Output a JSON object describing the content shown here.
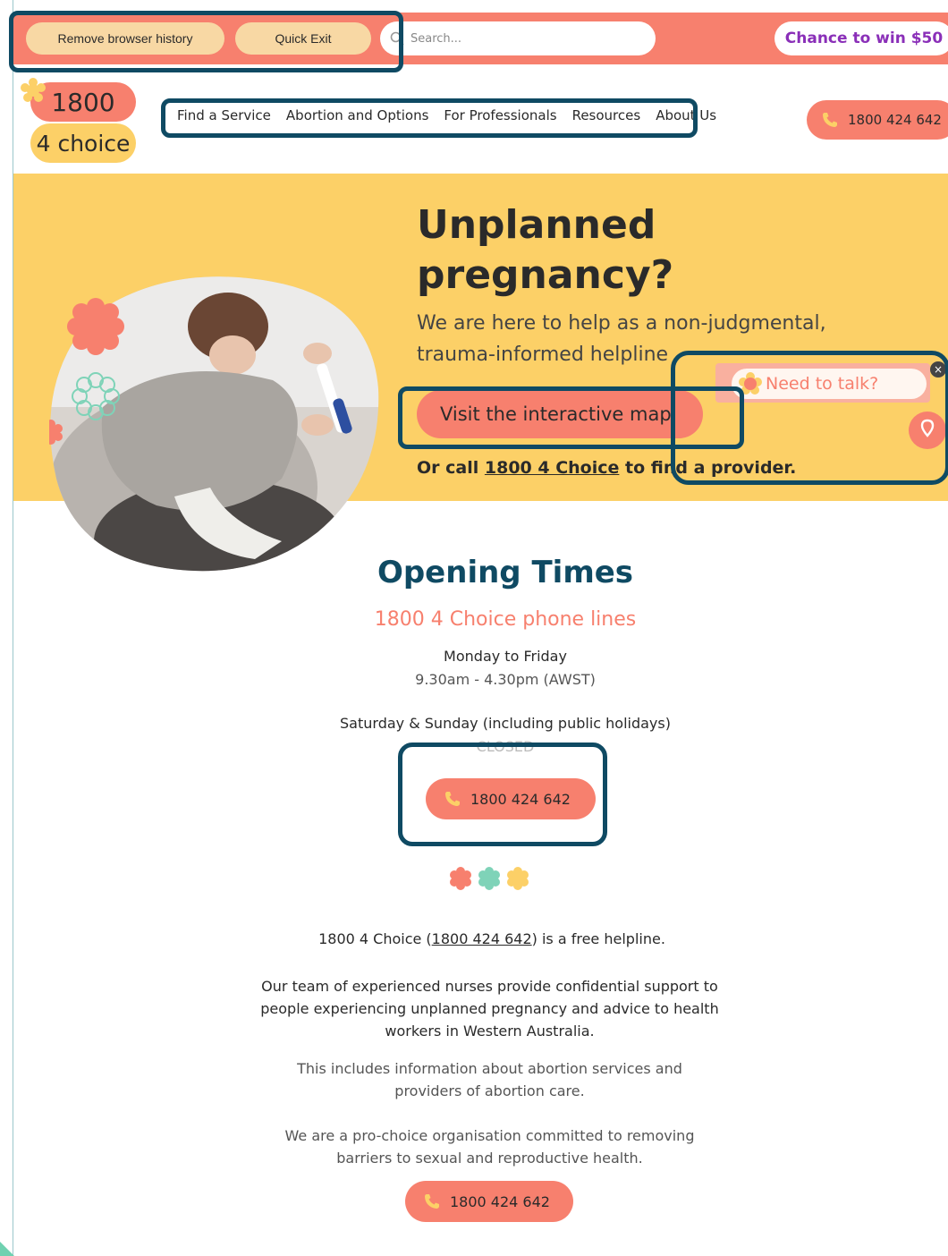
{
  "topbar": {
    "remove_history_label": "Remove browser history",
    "quick_exit_label": "Quick Exit",
    "search_placeholder": "Search...",
    "win_label": "Chance to win $50"
  },
  "logo": {
    "line1": "1800",
    "line2": "4 choice"
  },
  "nav": {
    "items": [
      "Find a Service",
      "Abortion and Options",
      "For Professionals",
      "Resources",
      "About Us"
    ],
    "call_label": "1800 424 642"
  },
  "hero": {
    "title": "Unplanned pregnancy?",
    "subtitle": "We are here to help as a non-judgmental, trauma-informed helpline",
    "map_button": "Visit the interactive map",
    "call_prefix": "Or call ",
    "call_link": "1800 4 Choice",
    "call_suffix": " to find a provider."
  },
  "widget": {
    "talk_label": "Need to talk?",
    "close_label": "×"
  },
  "opening": {
    "title": "Opening Times",
    "subtitle": "1800 4 Choice phone lines",
    "weekday_label": "Monday to Friday",
    "weekday_hours": "9.30am - 4.30pm (AWST)",
    "weekend_label": "Saturday & Sunday (including public holidays)",
    "weekend_hours": "CLOSED",
    "call_label": "1800 424 642"
  },
  "info": {
    "p1_prefix": "1800 4 Choice (",
    "p1_link": "1800 424 642",
    "p1_suffix": ") is a free helpline.",
    "p2": "Our team of experienced nurses provide confidential support to people experiencing unplanned pregnancy and advice to health workers in Western Australia.",
    "p3": "This includes information about abortion services and providers of abortion care.",
    "p4": "We are a pro-choice organisation committed to removing barriers to sexual and reproductive health.",
    "call_label": "1800 424 642"
  },
  "colors": {
    "coral": "#f7806e",
    "yellow": "#fcd067",
    "navy": "#0f4a63",
    "purple": "#8a2fb8",
    "annotation": "#0f4a63"
  }
}
